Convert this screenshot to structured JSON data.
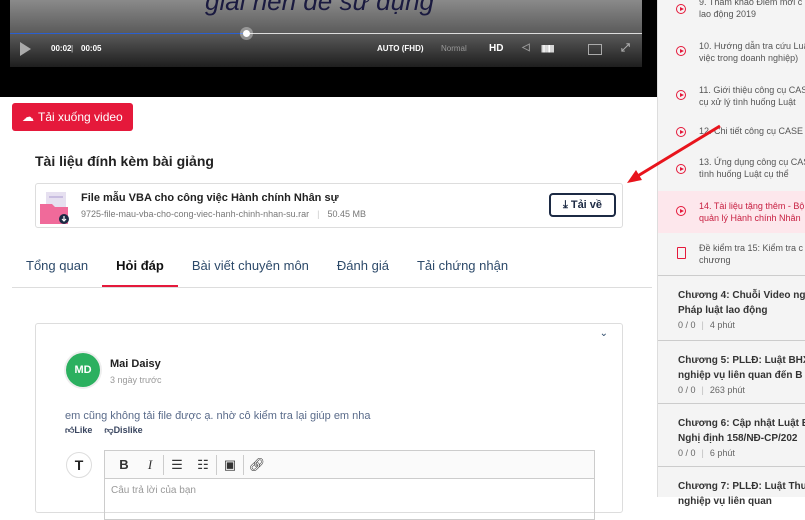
{
  "video": {
    "caption": "giải nén để sử dụng",
    "time_current": "00:02",
    "time_total": "00:05",
    "quality": "AUTO (FHD)",
    "speed": "Normal",
    "hd": "HD",
    "progress_fraction": 0.4
  },
  "download_video": "Tải xuống video",
  "attachments": {
    "title": "Tài liệu đính kèm bài giảng",
    "file_name": "File mẫu VBA cho công việc Hành chính Nhân sự",
    "file_path": "9725-file-mau-vba-cho-cong-viec-hanh-chinh-nhan-su.rar",
    "file_size": "50.45 MB",
    "download_label": "Tải về"
  },
  "tabs": [
    "Tổng quan",
    "Hỏi đáp",
    "Bài viết chuyên môn",
    "Đánh giá",
    "Tải chứng nhận"
  ],
  "comment": {
    "initials": "MD",
    "author": "Mai Daisy",
    "time": "3 ngày trước",
    "text": "em cũng không tải file được ạ. nhờ cô kiểm tra lại giúp em nha",
    "like": "Like",
    "dislike": "Dislike",
    "reply_placeholder": "Câu trả lời của bạn"
  },
  "sidebar": {
    "lessons": [
      {
        "line1": "9. Tham khảo Điểm mới c",
        "line2": "lao động 2019"
      },
      {
        "line1": "10. Hướng dẫn tra cứu Luật",
        "line2": "việc trong doanh nghiệp)"
      },
      {
        "line1": "11. Giới thiệu công cụ CAS",
        "line2": "cụ xử lý tình huống Luật"
      },
      {
        "line1": "12. Chi tiết công cụ CASE",
        "line2": ""
      },
      {
        "line1": "13. Ứng dụng công cụ CAS",
        "line2": "tình huống Luật cụ thể"
      },
      {
        "line1": "14. Tài liệu tặng thêm - Bộ",
        "line2": "quản lý Hành chính Nhân"
      },
      {
        "line1": "Đề kiểm tra 15: Kiểm tra c",
        "line2": "chương"
      }
    ],
    "chapters": [
      {
        "line1": "Chương 4: Chuỗi Video ng",
        "line2": "Pháp luật lao động",
        "progress": "0 / 0",
        "duration": "4 phút"
      },
      {
        "line1": "Chương 5: PLLĐ: Luật BHX",
        "line2": "nghiệp vụ liên quan đến B",
        "progress": "0 / 0",
        "duration": "263 phút"
      },
      {
        "line1": "Chương 6: Cập nhật Luật E",
        "line2": "Nghị định 158/NĐ-CP/202",
        "progress": "0 / 0",
        "duration": "6 phút"
      },
      {
        "line1": "Chương 7: PLLĐ: Luật Thu",
        "line2": "nghiệp vụ liên quan",
        "progress": "",
        "duration": ""
      }
    ]
  }
}
